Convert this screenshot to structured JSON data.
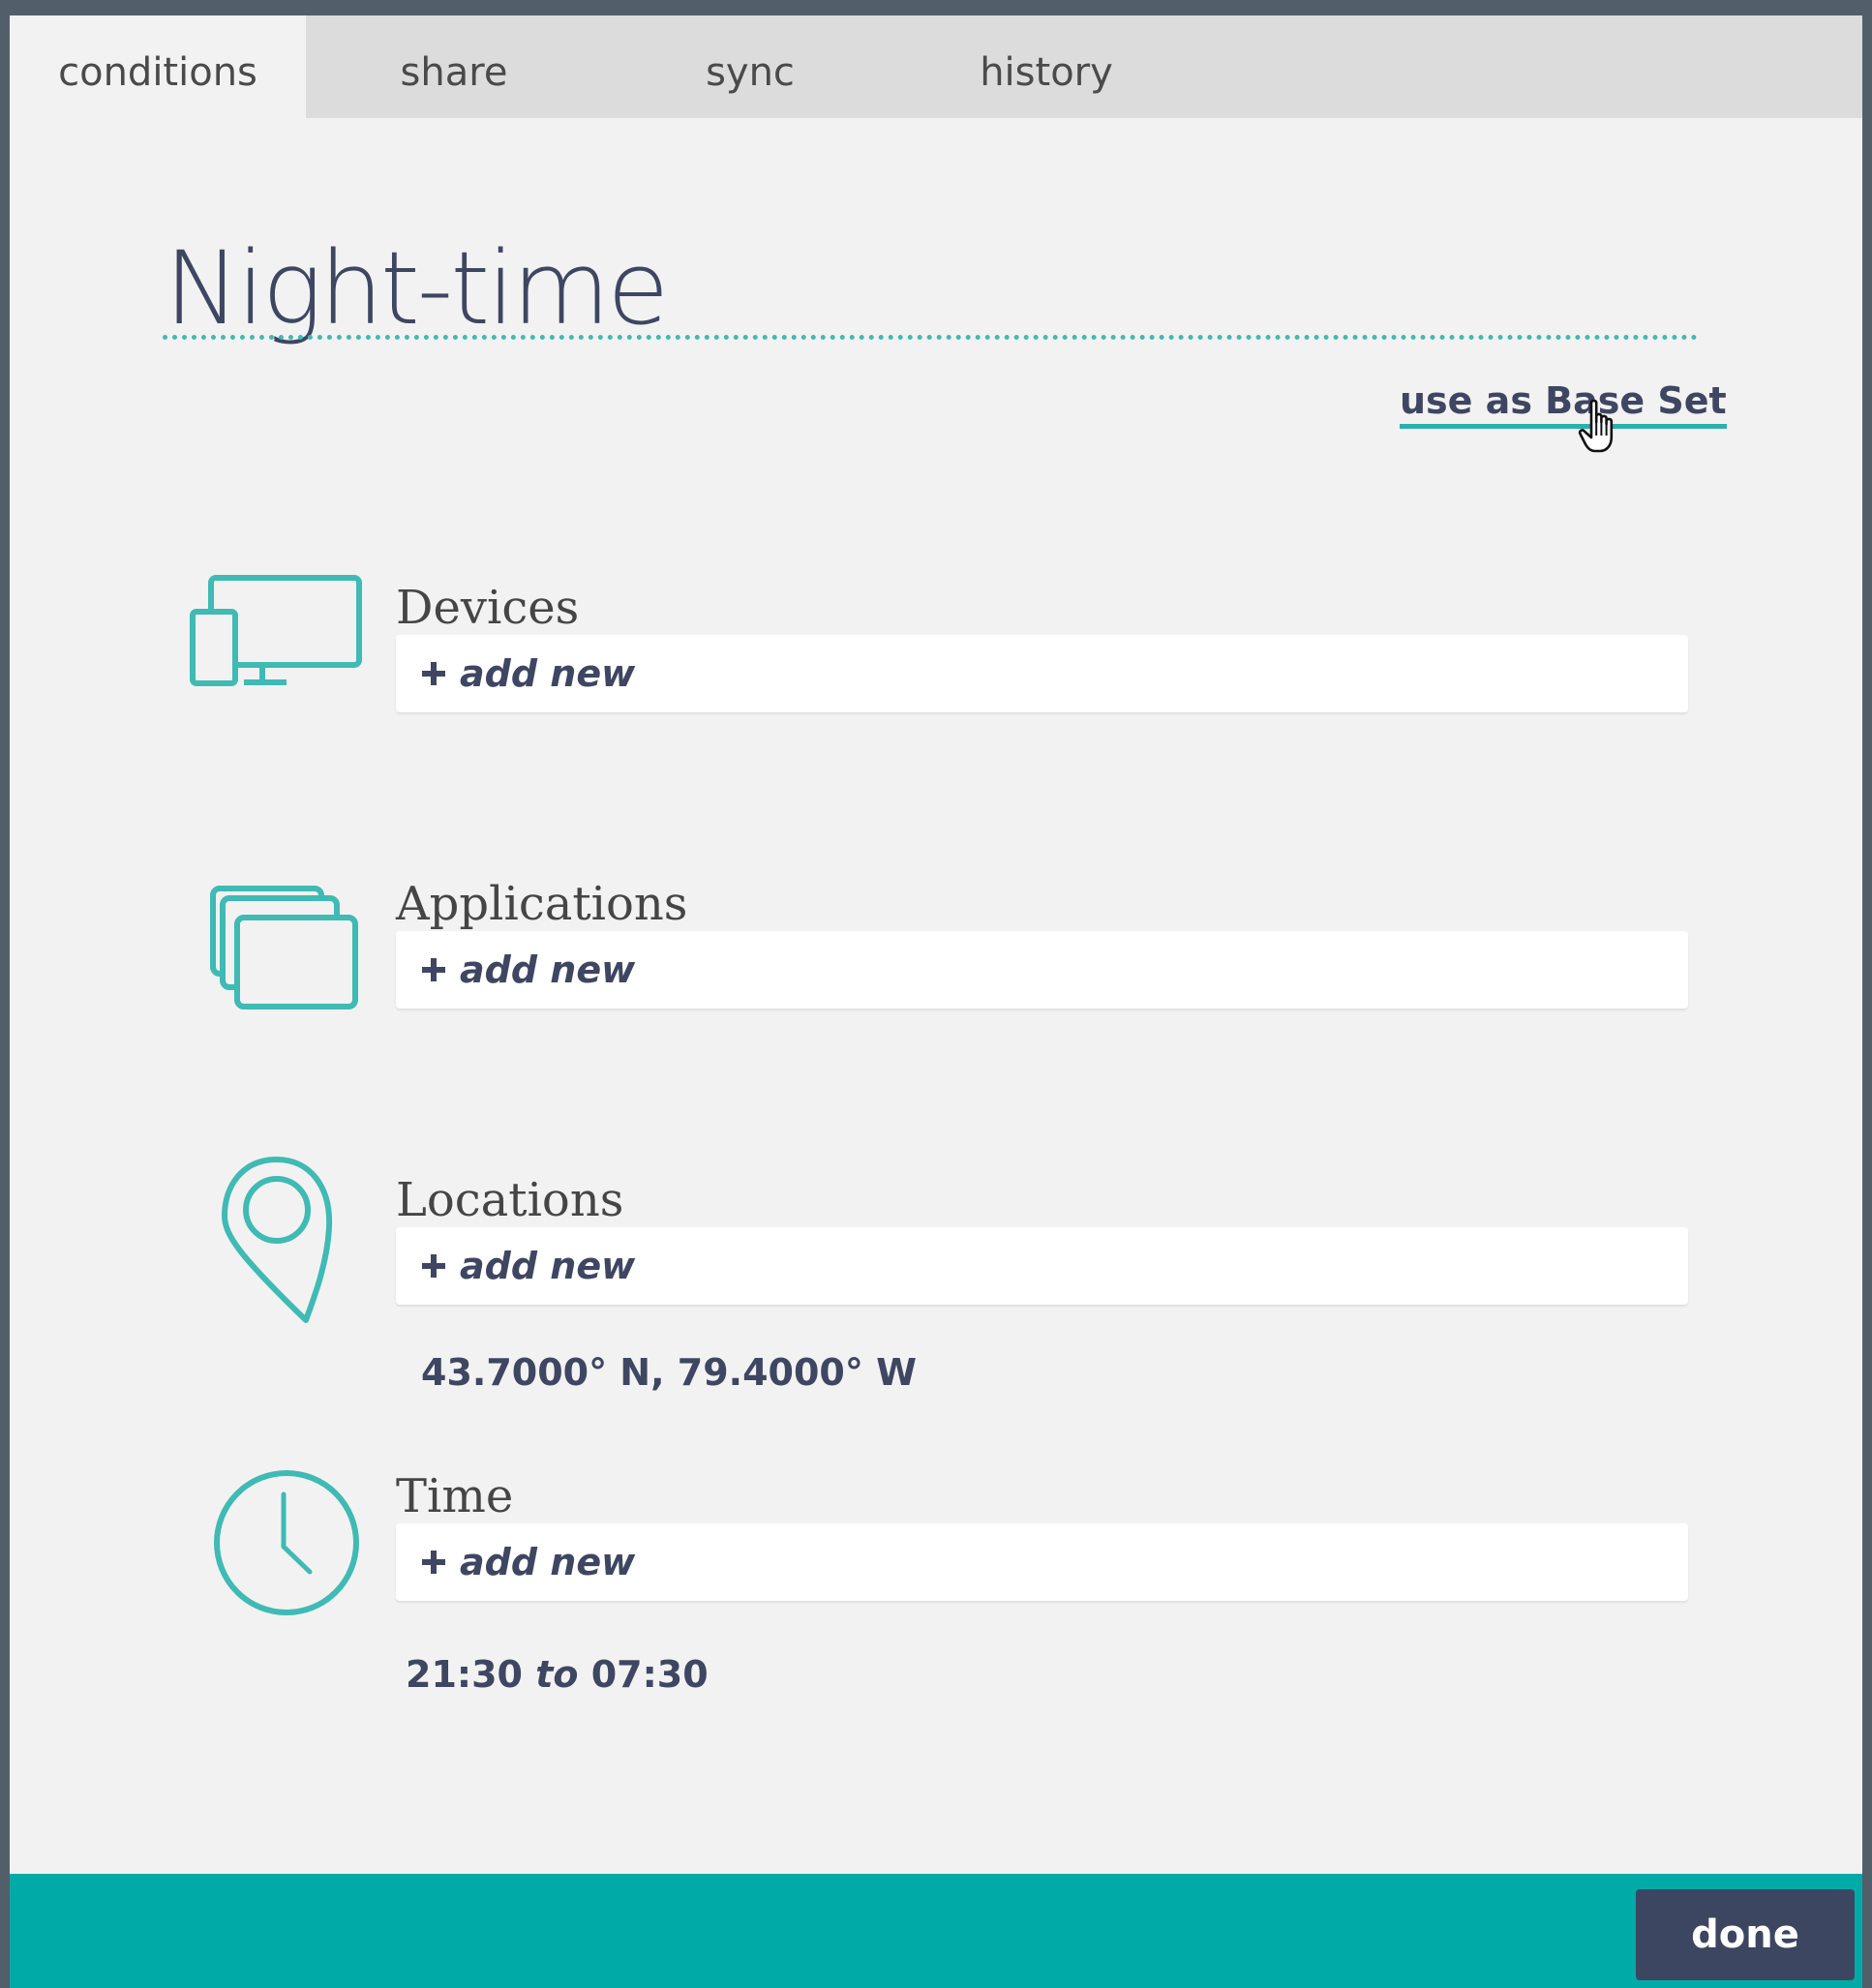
{
  "tabs": [
    {
      "label": "conditions"
    },
    {
      "label": "share"
    },
    {
      "label": "sync"
    },
    {
      "label": "history"
    }
  ],
  "title": "Night-time",
  "base_set_link": "use as Base Set",
  "sections": {
    "devices": {
      "label": "Devices",
      "add_label": "add new",
      "icon": "devices-icon"
    },
    "applications": {
      "label": "Applications",
      "add_label": "add new",
      "icon": "applications-icon"
    },
    "locations": {
      "label": "Locations",
      "add_label": "add new",
      "icon": "location-pin-icon",
      "value": "43.7000° N, 79.4000° W"
    },
    "time": {
      "label": "Time",
      "add_label": "add new",
      "icon": "clock-icon",
      "from": "21:30",
      "separator": "to",
      "to": "07:30"
    }
  },
  "footer": {
    "done_label": "done"
  },
  "colors": {
    "accent": "#3fbab4",
    "footer": "#00aba7",
    "button": "#3d4660",
    "text": "#3e4662"
  }
}
